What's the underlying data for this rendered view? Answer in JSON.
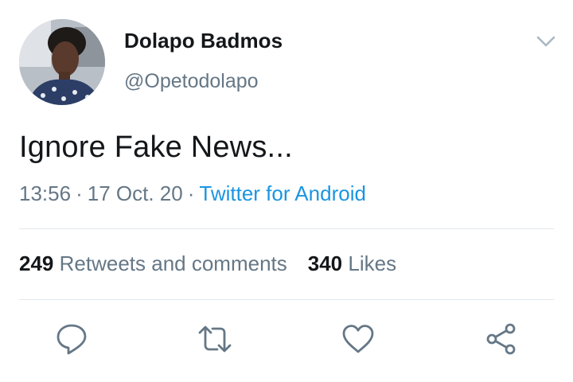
{
  "author": {
    "display_name": "Dolapo Badmos",
    "handle": "@Opetodolapo"
  },
  "tweet": {
    "text": "Ignore Fake News...",
    "time": "13:56",
    "date": "17 Oct. 20",
    "source": "Twitter for Android",
    "separator": "·"
  },
  "stats": {
    "retweets_count": "249",
    "retweets_label": "Retweets and comments",
    "likes_count": "340",
    "likes_label": "Likes"
  },
  "icons": {
    "menu": "chevron-down-icon",
    "reply": "reply-icon",
    "retweet": "retweet-icon",
    "like": "heart-icon",
    "share": "share-icon"
  },
  "colors": {
    "text_primary": "#14171a",
    "text_secondary": "#657786",
    "link": "#1b95e0",
    "divider": "#e1e8ed"
  }
}
